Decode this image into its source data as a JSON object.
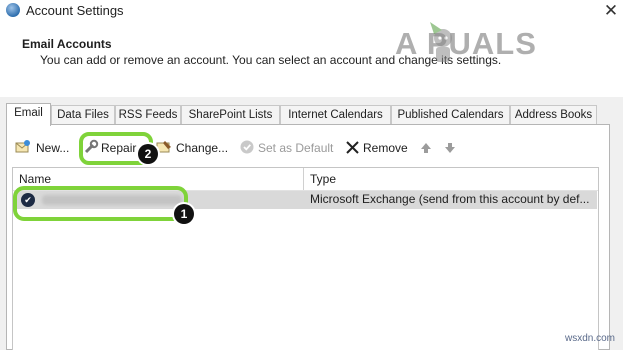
{
  "window": {
    "title": "Account Settings",
    "close_glyph": "✕"
  },
  "header": {
    "title": "Email Accounts",
    "description": "You can add or remove an account. You can select an account and change its settings."
  },
  "watermark": {
    "text": "A PUALS"
  },
  "tabs": [
    {
      "label": "Email",
      "active": true
    },
    {
      "label": "Data Files"
    },
    {
      "label": "RSS Feeds"
    },
    {
      "label": "SharePoint Lists"
    },
    {
      "label": "Internet Calendars"
    },
    {
      "label": "Published Calendars"
    },
    {
      "label": "Address Books"
    }
  ],
  "toolbar": {
    "new_label": "New...",
    "repair_label": "Repair...",
    "change_label": "Change...",
    "set_default_label": "Set as Default",
    "remove_label": "Remove",
    "icons": [
      "new-account-icon",
      "repair-icon",
      "change-icon",
      "set-default-icon",
      "remove-icon",
      "move-up-icon",
      "move-down-icon"
    ]
  },
  "list": {
    "columns": [
      "Name",
      "Type"
    ],
    "rows": [
      {
        "name": "",
        "type": "Microsoft Exchange (send from this account by def...",
        "default": true
      }
    ]
  },
  "annotations": {
    "badge1": "1",
    "badge2": "2",
    "highlight_color": "#7fd33a"
  },
  "footer": {
    "site": "wsxdn.com"
  }
}
